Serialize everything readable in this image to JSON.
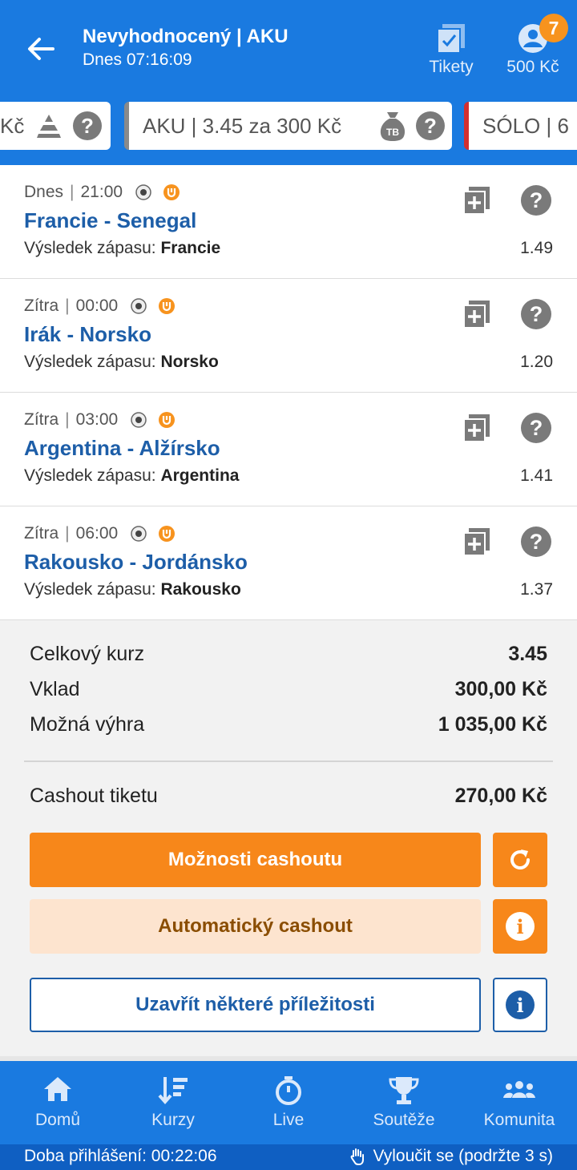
{
  "header": {
    "title": "Nevyhodnocený | AKU",
    "subtitle": "Dnes 07:16:09",
    "tickets_label": "Tikety",
    "balance": "500 Kč",
    "badge_count": "7"
  },
  "ticket_strip": {
    "left_card": "Kč",
    "middle_card": "AKU  | 3.45 za 300 Kč",
    "middle_icon_text": "TB",
    "right_card": "SÓLO  | 6",
    "help": "?"
  },
  "events": [
    {
      "day": "Dnes",
      "time": "21:00",
      "name": "Francie - Senegal",
      "market": "Výsledek zápasu:",
      "pick": "Francie",
      "odds": "1.49"
    },
    {
      "day": "Zítra",
      "time": "00:00",
      "name": "Irák - Norsko",
      "market": "Výsledek zápasu:",
      "pick": "Norsko",
      "odds": "1.20"
    },
    {
      "day": "Zítra",
      "time": "03:00",
      "name": "Argentina - Alžírsko",
      "market": "Výsledek zápasu:",
      "pick": "Argentina",
      "odds": "1.41"
    },
    {
      "day": "Zítra",
      "time": "06:00",
      "name": "Rakousko - Jordánsko",
      "market": "Výsledek zápasu:",
      "pick": "Rakousko",
      "odds": "1.37"
    }
  ],
  "summary": {
    "total_odds_label": "Celkový kurz",
    "total_odds": "3.45",
    "stake_label": "Vklad",
    "stake": "300,00 Kč",
    "win_label": "Možná výhra",
    "win": "1 035,00 Kč",
    "cashout_label": "Cashout tiketu",
    "cashout": "270,00 Kč"
  },
  "buttons": {
    "cashout_options": "Možnosti cashoutu",
    "auto_cashout": "Automatický cashout",
    "close_some": "Uzavřít některé příležitosti"
  },
  "nav": [
    {
      "label": "Domů",
      "icon": "home-icon"
    },
    {
      "label": "Kurzy",
      "icon": "odds-icon"
    },
    {
      "label": "Live",
      "icon": "stopwatch-icon"
    },
    {
      "label": "Soutěže",
      "icon": "trophy-icon"
    },
    {
      "label": "Komunita",
      "icon": "community-icon"
    }
  ],
  "status_bar": {
    "login_time": "Doba přihlášení: 00:22:06",
    "exclude": "Vyloučit se (podržte 3 s)"
  },
  "colors": {
    "primary": "#1a7ae0",
    "accent": "#f7871a",
    "link": "#1d5ea8"
  }
}
